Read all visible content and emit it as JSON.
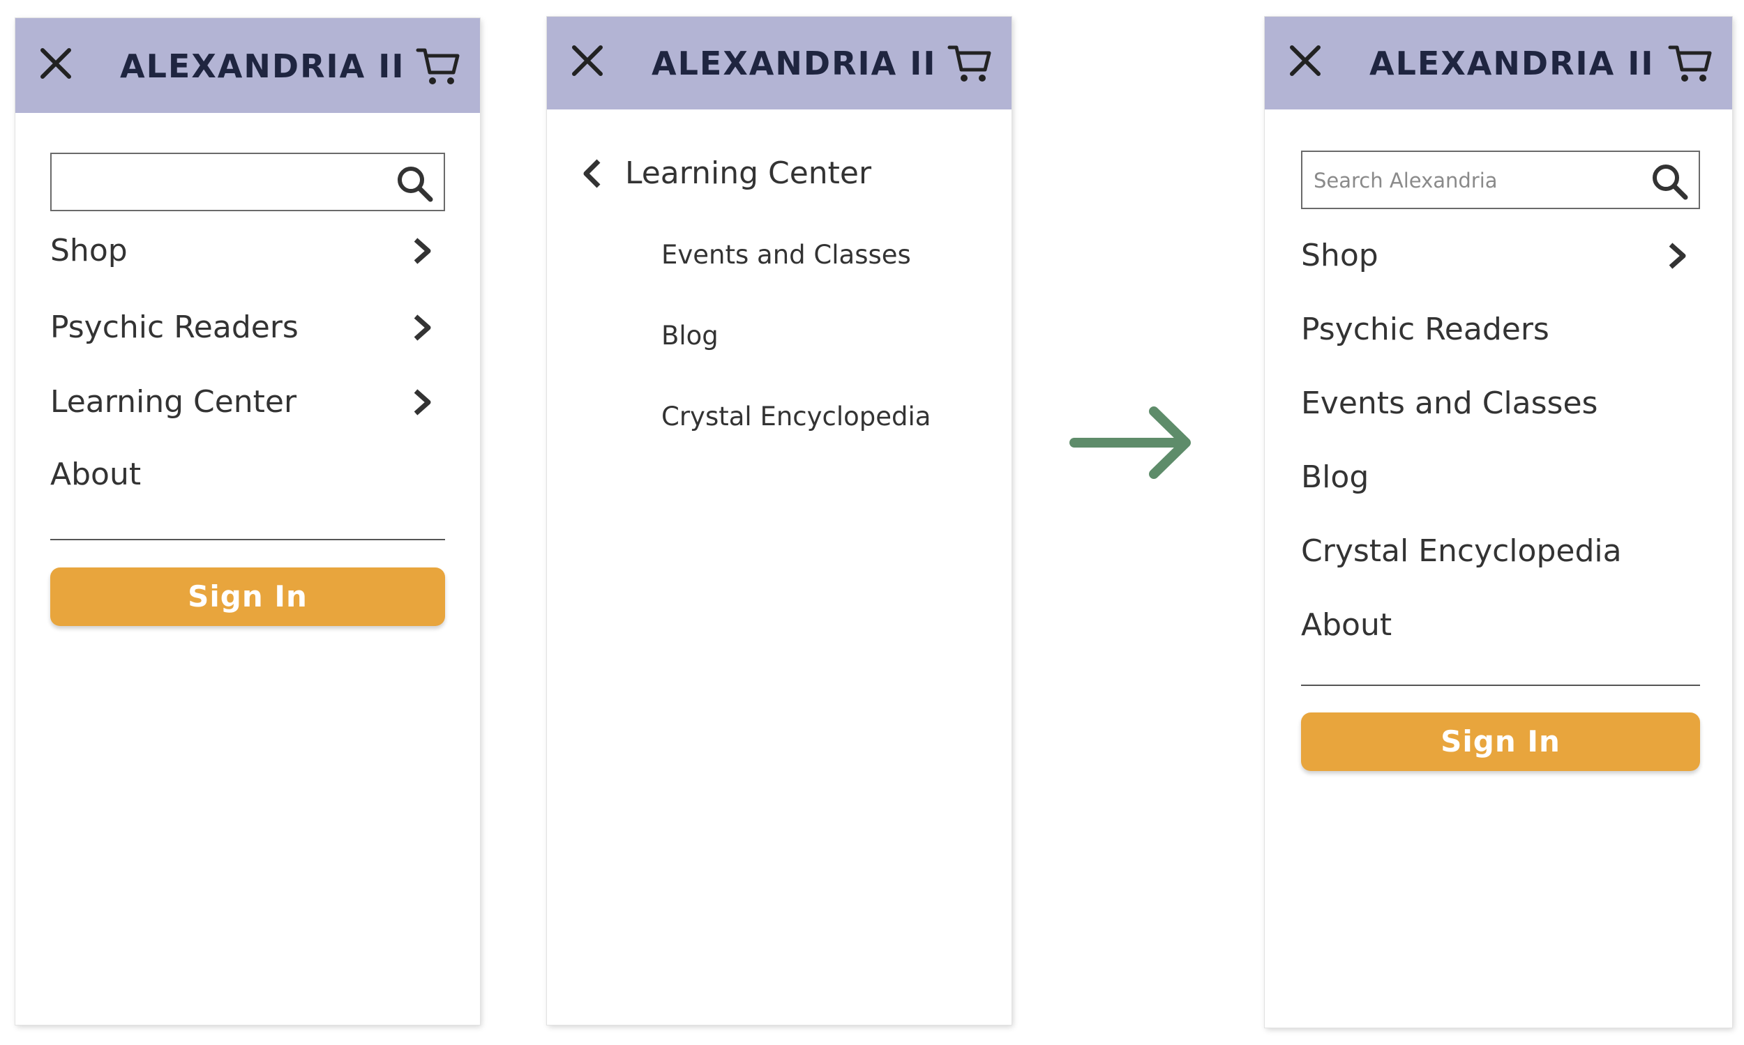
{
  "brand": "ALEXANDRIA II",
  "colors": {
    "header": "#b3b4d4",
    "accent": "#e8a53d",
    "arrow": "#5e8c6a",
    "text": "#333333"
  },
  "icons": {
    "close": "close-icon",
    "cart": "cart-icon",
    "search": "search-icon",
    "chevron_right": "chevron-right-icon",
    "chevron_left": "chevron-left-icon",
    "arrow": "arrow-right-icon"
  },
  "panel_a": {
    "search": {
      "value": "",
      "placeholder": ""
    },
    "nav": [
      "Shop",
      "Psychic Readers",
      "Learning Center",
      "About"
    ],
    "sign_in": "Sign In"
  },
  "panel_b": {
    "back_label": "Learning Center",
    "items": [
      "Events and Classes",
      "Blog",
      "Crystal Encyclopedia"
    ]
  },
  "panel_c": {
    "search": {
      "value": "",
      "placeholder": "Search Alexandria"
    },
    "nav": [
      "Shop",
      "Psychic Readers",
      "Events and Classes",
      "Blog",
      "Crystal Encyclopedia",
      "About"
    ],
    "sign_in": "Sign In"
  }
}
